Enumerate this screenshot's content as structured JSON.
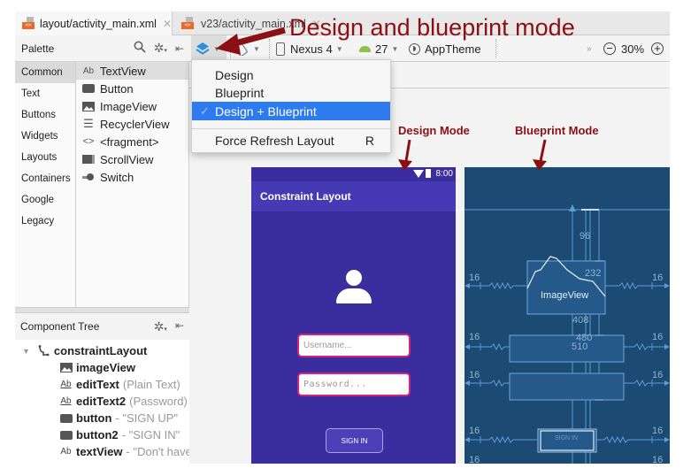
{
  "tabs": [
    {
      "label": "layout/activity_main.xml",
      "active": true
    },
    {
      "label": "v23/activity_main.xml",
      "active": false
    }
  ],
  "palette": {
    "title": "Palette",
    "categories": [
      "Common",
      "Text",
      "Buttons",
      "Widgets",
      "Layouts",
      "Containers",
      "Google",
      "Legacy"
    ],
    "selected_category": "Common",
    "items": [
      {
        "icon": "textview-icon",
        "glyph": "Ab",
        "label": "TextView"
      },
      {
        "icon": "button-icon",
        "glyph": "",
        "label": "Button"
      },
      {
        "icon": "imageview-icon",
        "glyph": "",
        "label": "ImageView"
      },
      {
        "icon": "list-icon",
        "glyph": "☰",
        "label": "RecyclerView"
      },
      {
        "icon": "code-icon",
        "glyph": "<>",
        "label": "<fragment>"
      },
      {
        "icon": "scrollview-icon",
        "glyph": "",
        "label": "ScrollView"
      },
      {
        "icon": "switch-icon",
        "glyph": "",
        "label": "Switch"
      }
    ]
  },
  "toolbar": {
    "device": "Nexus 4",
    "api_level": "27",
    "theme": "AppTheme",
    "zoom": "30%",
    "overflow": "»"
  },
  "menu": {
    "items": [
      {
        "label": "Design",
        "selected": false,
        "shortcut": ""
      },
      {
        "label": "Blueprint",
        "selected": false,
        "shortcut": ""
      },
      {
        "label": "Design + Blueprint",
        "selected": true,
        "shortcut": ""
      },
      {
        "label": "Force Refresh Layout",
        "selected": false,
        "shortcut": "R"
      }
    ],
    "check_glyph": "✓"
  },
  "component_tree": {
    "title": "Component Tree",
    "nodes": [
      {
        "name": "constraintLayout",
        "detail": "",
        "icon": "constraint-layout-icon",
        "level": 0
      },
      {
        "name": "imageView",
        "detail": "",
        "icon": "imageview-icon",
        "level": 1
      },
      {
        "name": "editText",
        "detail": "(Plain Text)",
        "icon": "edittext-icon",
        "level": 1
      },
      {
        "name": "editText2",
        "detail": "(Password)",
        "icon": "edittext-icon",
        "level": 1
      },
      {
        "name": "button",
        "detail": "- \"SIGN UP\"",
        "icon": "button-icon",
        "level": 1
      },
      {
        "name": "button2",
        "detail": "- \"SIGN IN\"",
        "icon": "button-icon",
        "level": 1
      },
      {
        "name": "textView",
        "detail": "- \"Don't have an account?\"",
        "icon": "textview-icon",
        "level": 1
      }
    ]
  },
  "phone": {
    "time": "8:00",
    "app_title": "Constraint Layout",
    "username_placeholder": "Username...",
    "password_placeholder": "Password...",
    "signin_label": "SIGN IN"
  },
  "blueprint": {
    "margins": [
      "16",
      "16",
      "16",
      "16",
      "16",
      "16",
      "16",
      "16",
      "16",
      "16"
    ],
    "dim_96": "96",
    "dim_232": "232",
    "dim_408": "408",
    "dim_480": "480",
    "dim_510": "510",
    "imageview_label": "ImageView",
    "signin_label": "SIGN IN"
  },
  "annotations": {
    "title": "Design and blueprint mode",
    "design_mode": "Design Mode",
    "blueprint_mode": "Blueprint Mode"
  },
  "colors": {
    "annotation": "#8b1014",
    "phone_bg": "#3a2e9e",
    "appbar": "#4539b4",
    "blueprint_bg": "#1b4a72",
    "menu_selected": "#2e7bf0",
    "field_border": "#d4237f"
  }
}
